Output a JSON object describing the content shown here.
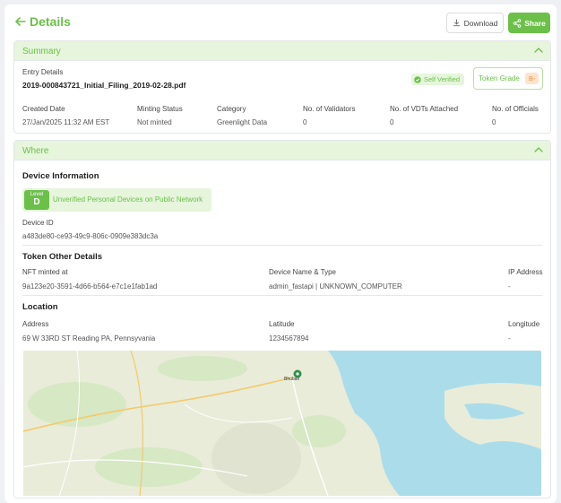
{
  "header": {
    "title": "Details",
    "download_label": "Download",
    "share_label": "Share"
  },
  "summary": {
    "title": "Summary",
    "entry_details_label": "Entry Details",
    "file_name": "2019-000843721_Initial_Filing_2019-02-28.pdf",
    "self_verified_label": "Self Verified",
    "token_grade_label": "Token Grade",
    "token_grade_value": "B-",
    "fields": [
      {
        "label": "Created Date",
        "value": "27/Jan/2025 11:32 AM EST"
      },
      {
        "label": "Minting Status",
        "value": "Not minted"
      },
      {
        "label": "Category",
        "value": "Greenlight Data"
      },
      {
        "label": "No. of Validators",
        "value": "0"
      },
      {
        "label": "No. of VDTs Attached",
        "value": "0"
      },
      {
        "label": "No. of Officials",
        "value": "0"
      }
    ]
  },
  "where": {
    "title": "Where",
    "device_info_title": "Device Information",
    "level_label": "Level",
    "level_value": "D",
    "level_text": "Unverified Personal Devices on Public Network",
    "device_id_label": "Device ID",
    "device_id_value": "a483de80-ce93-49c9-806c-0909e383dc3a",
    "token_other_title": "Token Other Details",
    "nft_minted_label": "NFT minted at",
    "nft_minted_value": "9a123e20-3591-4d66-b564-e7c1e1fab1ad",
    "device_name_label": "Device Name & Type",
    "device_name_value": "admin_fastapi | UNKNOWN_COMPUTER",
    "ip_label": "IP Address",
    "ip_value": "-",
    "location_title": "Location",
    "address_label": "Address",
    "address_value": "69 W 33RD ST Reading PA, Pennsyvania",
    "latitude_label": "Latitude",
    "latitude_value": "1234567894",
    "longitude_label": "Longitude",
    "longitude_value": "-",
    "map_marker_label": "Bhuban",
    "colors": {
      "accent": "#6cc04a",
      "water": "#abdcea",
      "land": "#e9ecd9"
    }
  }
}
